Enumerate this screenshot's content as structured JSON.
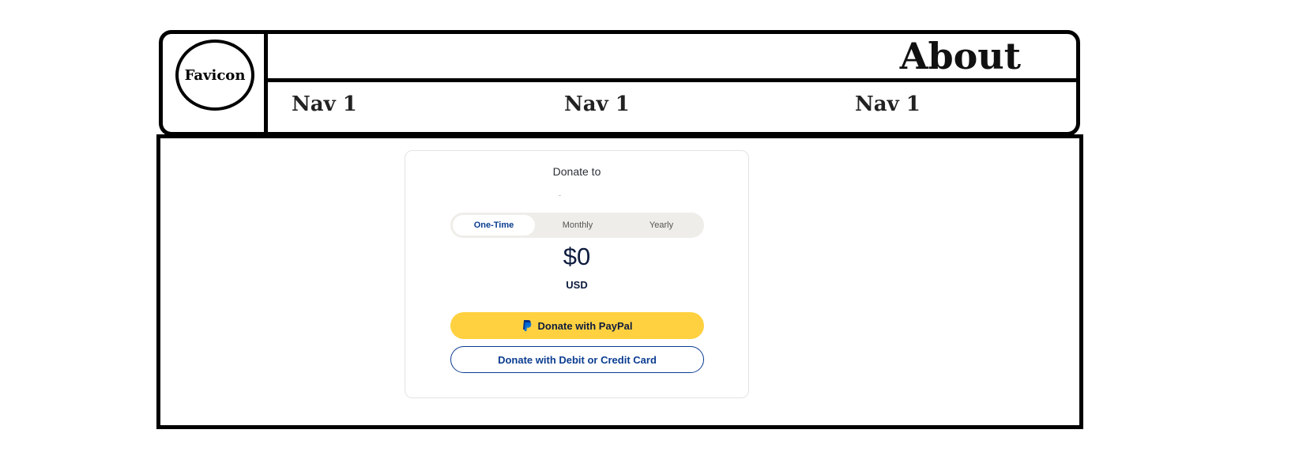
{
  "header": {
    "favicon_label": "Favicon",
    "title": "About",
    "nav": [
      "Nav 1",
      "Nav 1",
      "Nav 1"
    ]
  },
  "donate": {
    "heading": "Donate to",
    "frequency": {
      "options": [
        "One-Time",
        "Monthly",
        "Yearly"
      ],
      "selected": "One-Time"
    },
    "amount": "$0",
    "currency": "USD",
    "paypal_button": "Donate with PayPal",
    "card_button": "Donate with Debit or Credit Card"
  },
  "colors": {
    "paypal_yellow": "#ffd140",
    "accent_blue": "#0b3d91",
    "toggle_bg": "#efede9"
  },
  "icons": {
    "paypal": "paypal-icon",
    "favicon": "favicon-circle"
  }
}
